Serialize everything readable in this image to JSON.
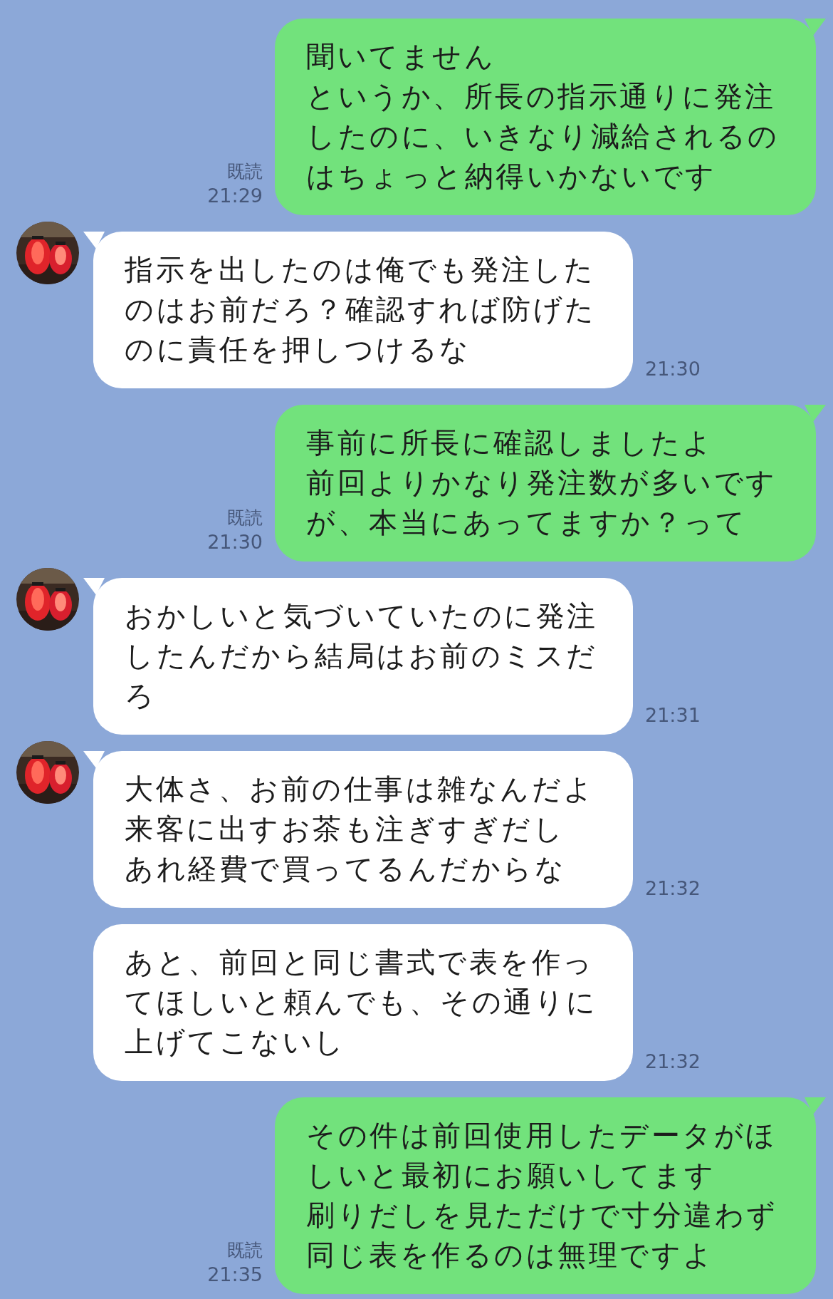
{
  "messages": [
    {
      "kind": "sent",
      "lines": [
        "聞いてません",
        "というか、所長の指示通りに発注したのに、いきなり減給されるのはちょっと納得いかないです"
      ],
      "read": "既読",
      "time": "21:29"
    },
    {
      "kind": "received",
      "avatar": true,
      "lines": [
        "指示を出したのは俺でも発注したのはお前だろ？確認すれば防げたのに責任を押しつけるな"
      ],
      "time": "21:30"
    },
    {
      "kind": "sent",
      "lines": [
        "事前に所長に確認しましたよ",
        "前回よりかなり発注数が多いですが、本当にあってますか？って"
      ],
      "read": "既読",
      "time": "21:30"
    },
    {
      "kind": "received",
      "avatar": true,
      "lines": [
        "おかしいと気づいていたのに発注したんだから結局はお前のミスだろ"
      ],
      "time": "21:31"
    },
    {
      "kind": "received",
      "avatar": true,
      "lines": [
        "大体さ、お前の仕事は雑なんだよ",
        "来客に出すお茶も注ぎすぎだし",
        "あれ経費で買ってるんだからな"
      ],
      "time": "21:32"
    },
    {
      "kind": "received",
      "avatar": false,
      "lines": [
        "あと、前回と同じ書式で表を作ってほしいと頼んでも、その通りに上げてこないし"
      ],
      "time": "21:32"
    },
    {
      "kind": "sent",
      "lines": [
        "その件は前回使用したデータがほしいと最初にお願いしてます",
        "刷りだしを見ただけで寸分違わず同じ表を作るのは無理ですよ"
      ],
      "read": "既読",
      "time": "21:35"
    }
  ]
}
